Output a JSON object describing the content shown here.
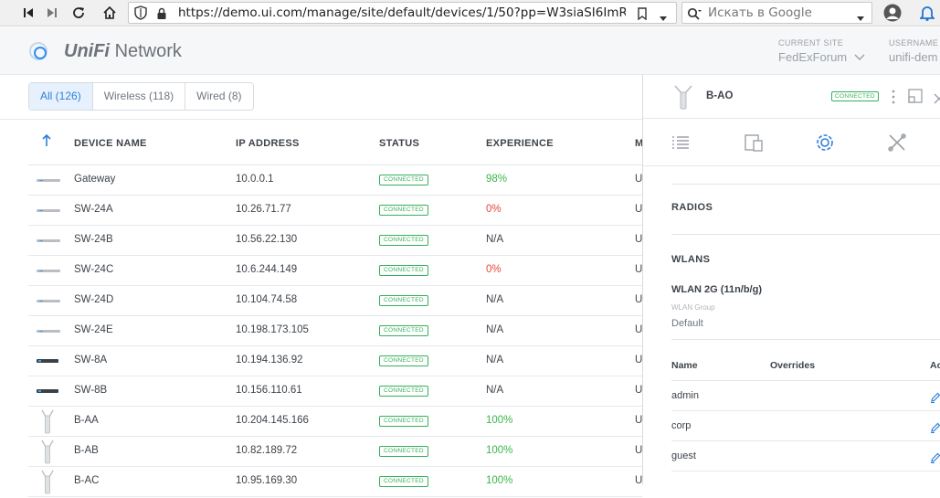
{
  "browser": {
    "url": "https://demo.ui.com/manage/site/default/devices/1/50?pp=W3siaSI6ImRl...",
    "search_placeholder": "Искать в Google"
  },
  "header": {
    "logo_brand": "UniFi",
    "logo_product": "Network",
    "current_site_label": "CURRENT SITE",
    "current_site_value": "FedExForum",
    "username_label": "USERNAME",
    "username_value": "unifi-dem"
  },
  "filters": [
    {
      "label": "All (126)",
      "active": true
    },
    {
      "label": "Wireless (118)",
      "active": false
    },
    {
      "label": "Wired (8)",
      "active": false
    }
  ],
  "table": {
    "columns": [
      "DEVICE NAME",
      "IP ADDRESS",
      "STATUS",
      "EXPERIENCE",
      "M"
    ],
    "rows": [
      {
        "icon": "gateway-device-icon",
        "name": "Gateway",
        "ip": "10.0.0.1",
        "status": "CONNECTED",
        "experience": "98%",
        "exp_class": "good",
        "model": "U"
      },
      {
        "icon": "switch-device-icon",
        "name": "SW-24A",
        "ip": "10.26.71.77",
        "status": "CONNECTED",
        "experience": "0%",
        "exp_class": "bad",
        "model": "U"
      },
      {
        "icon": "switch-device-icon",
        "name": "SW-24B",
        "ip": "10.56.22.130",
        "status": "CONNECTED",
        "experience": "N/A",
        "exp_class": "",
        "model": "U"
      },
      {
        "icon": "switch-device-icon",
        "name": "SW-24C",
        "ip": "10.6.244.149",
        "status": "CONNECTED",
        "experience": "0%",
        "exp_class": "bad",
        "model": "U"
      },
      {
        "icon": "switch-device-icon",
        "name": "SW-24D",
        "ip": "10.104.74.58",
        "status": "CONNECTED",
        "experience": "N/A",
        "exp_class": "",
        "model": "U"
      },
      {
        "icon": "switch-device-icon",
        "name": "SW-24E",
        "ip": "10.198.173.105",
        "status": "CONNECTED",
        "experience": "N/A",
        "exp_class": "",
        "model": "U"
      },
      {
        "icon": "small-switch-device-icon",
        "name": "SW-8A",
        "ip": "10.194.136.92",
        "status": "CONNECTED",
        "experience": "N/A",
        "exp_class": "",
        "model": "U"
      },
      {
        "icon": "small-switch-device-icon",
        "name": "SW-8B",
        "ip": "10.156.110.61",
        "status": "CONNECTED",
        "experience": "N/A",
        "exp_class": "",
        "model": "U"
      },
      {
        "icon": "access-point-icon",
        "name": "B-AA",
        "ip": "10.204.145.166",
        "status": "CONNECTED",
        "experience": "100%",
        "exp_class": "good",
        "model": "U"
      },
      {
        "icon": "access-point-icon",
        "name": "B-AB",
        "ip": "10.82.189.72",
        "status": "CONNECTED",
        "experience": "100%",
        "exp_class": "good",
        "model": "U"
      },
      {
        "icon": "access-point-icon",
        "name": "B-AC",
        "ip": "10.95.169.30",
        "status": "CONNECTED",
        "experience": "100%",
        "exp_class": "good",
        "model": "U"
      }
    ]
  },
  "panel": {
    "title": "B-AO",
    "status": "CONNECTED",
    "radios_heading": "RADIOS",
    "wlans_heading": "WLANS",
    "wlan_name": "WLAN 2G (11n/b/g)",
    "wlan_group_label": "WLAN Group",
    "wlan_group_value": "Default",
    "wlan_table_headers": [
      "Name",
      "Overrides",
      "Ac"
    ],
    "wlan_rows": [
      "admin",
      "corp",
      "guest"
    ]
  },
  "colors": {
    "accent": "#2f7fd9",
    "connected": "#35b05a",
    "experience_good": "#3cb64b",
    "experience_bad": "#e4483d"
  }
}
